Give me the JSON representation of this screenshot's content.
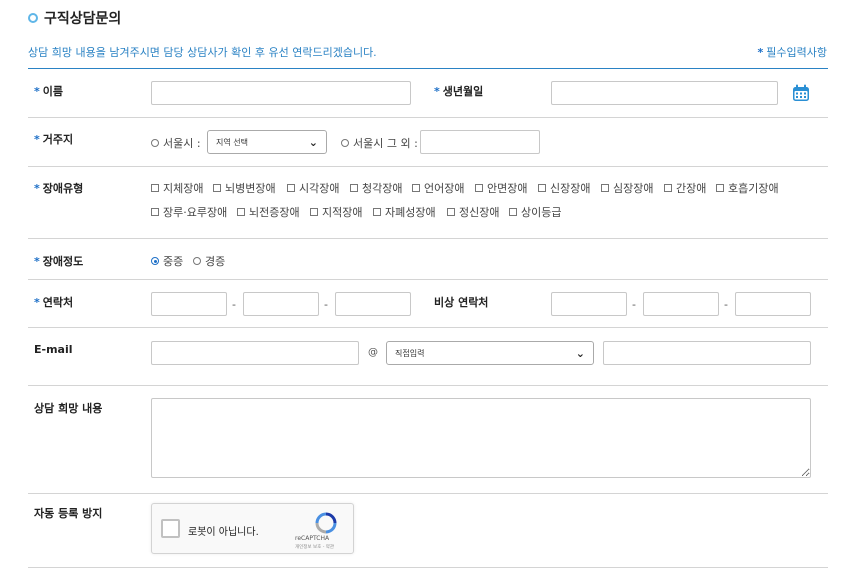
{
  "page_title": "구직상담문의",
  "description": "상담 희망 내용을 남겨주시면 담당 상담사가 확인 후 유선 연락드리겠습니다.",
  "required_note": "필수입력사항",
  "required_mark": "*",
  "fields": {
    "name_label": "이름",
    "birth_label": "생년월일",
    "residence_label": "거주지",
    "residence_seoul": "서울시 :",
    "residence_select": "지역 선택",
    "residence_outside": "서울시 그 외 :",
    "disability_type_label": "장애유형",
    "disability_types": [
      "지체장애",
      "뇌병변장애",
      "시각장애",
      "청각장애",
      "언어장애",
      "안면장애",
      "신장장애",
      "심장장애",
      "간장애",
      "호흡기장애",
      "장루·요루장애",
      "뇌전증장애",
      "지적장애",
      "자폐성장애",
      "정신장애",
      "상이등급"
    ],
    "severity_label": "장애정도",
    "severity_options": [
      "중증",
      "경증"
    ],
    "contact_label": "연락처",
    "emergency_label": "비상 연락처",
    "dash": "-",
    "email_label": "E-mail",
    "email_at": "@",
    "email_domain_select": "직접입력",
    "consult_label": "상담 희망 내용",
    "antispam_label": "자동 등록 방지"
  },
  "captcha": {
    "label": "로봇이 아닙니다.",
    "brand": "reCAPTCHA",
    "terms": "개인정보 보호 - 약관"
  },
  "colors": {
    "accent": "#2a82c4",
    "required": "#1d6fc7",
    "calendar": "#2a8fd4"
  }
}
